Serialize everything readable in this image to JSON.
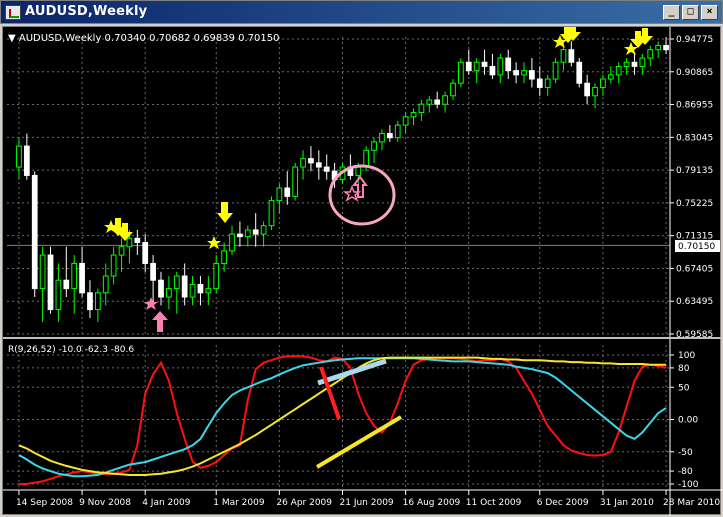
{
  "window": {
    "title": "AUDUSD,Weekly",
    "buttons": {
      "minimize": "_",
      "restore": "□",
      "close": "×"
    }
  },
  "colors": {
    "background": "#000000",
    "bull_candle": "#00ff00",
    "bear_candle": "#ffffff",
    "grid": "#6c6c6c",
    "wpr_line": "#ff1010",
    "signal_cyan": "#3ad7e8",
    "signal_yellow": "#f5e62a",
    "arrow_yellow": "#ffff00",
    "arrow_pink": "#ff7fb4",
    "circle_pink": "#f7a7c1"
  },
  "main": {
    "header": "▼ AUDUSD,Weekly  0.70340 0.70682 0.69839 0.70150",
    "current_price": "0.70150",
    "price_ticks": [
      "0.94775",
      "0.90865",
      "0.86955",
      "0.83045",
      "0.79135",
      "0.75225",
      "0.71315",
      "0.67405",
      "0.63495",
      "0.59585"
    ]
  },
  "indicator": {
    "header": "R(9,26,52) -10.0 -62.3 -80.6",
    "ticks": [
      "100",
      "80",
      "50",
      "0.00",
      "-50",
      "-80",
      "-100"
    ]
  },
  "time_axis": {
    "labels": [
      "14 Sep 2008",
      "9 Nov 2008",
      "4 Jan 2009",
      "1 Mar 2009",
      "26 Apr 2009",
      "21 Jun 2009",
      "16 Aug 2009",
      "11 Oct 2009",
      "6 Dec 2009",
      "31 Jan 2010",
      "28 Mar 2010"
    ]
  },
  "chart_data": {
    "type": "candlestick",
    "symbol": "AUDUSD",
    "timeframe": "Weekly",
    "price_range": [
      0.59585,
      0.94775
    ],
    "indicator_range": [
      -100,
      100
    ],
    "candles": [
      {
        "o": 0.795,
        "h": 0.83,
        "l": 0.78,
        "c": 0.82
      },
      {
        "o": 0.82,
        "h": 0.835,
        "l": 0.78,
        "c": 0.785
      },
      {
        "o": 0.785,
        "h": 0.79,
        "l": 0.64,
        "c": 0.65
      },
      {
        "o": 0.65,
        "h": 0.7,
        "l": 0.61,
        "c": 0.69
      },
      {
        "o": 0.69,
        "h": 0.7,
        "l": 0.62,
        "c": 0.625
      },
      {
        "o": 0.625,
        "h": 0.68,
        "l": 0.61,
        "c": 0.66
      },
      {
        "o": 0.66,
        "h": 0.7,
        "l": 0.64,
        "c": 0.65
      },
      {
        "o": 0.65,
        "h": 0.69,
        "l": 0.62,
        "c": 0.68
      },
      {
        "o": 0.68,
        "h": 0.7,
        "l": 0.64,
        "c": 0.645
      },
      {
        "o": 0.645,
        "h": 0.66,
        "l": 0.615,
        "c": 0.625
      },
      {
        "o": 0.625,
        "h": 0.65,
        "l": 0.61,
        "c": 0.645
      },
      {
        "o": 0.645,
        "h": 0.68,
        "l": 0.63,
        "c": 0.665
      },
      {
        "o": 0.665,
        "h": 0.7,
        "l": 0.655,
        "c": 0.69
      },
      {
        "o": 0.69,
        "h": 0.71,
        "l": 0.67,
        "c": 0.7
      },
      {
        "o": 0.7,
        "h": 0.72,
        "l": 0.68,
        "c": 0.71
      },
      {
        "o": 0.71,
        "h": 0.72,
        "l": 0.69,
        "c": 0.705
      },
      {
        "o": 0.705,
        "h": 0.715,
        "l": 0.67,
        "c": 0.68
      },
      {
        "o": 0.68,
        "h": 0.69,
        "l": 0.63,
        "c": 0.66
      },
      {
        "o": 0.66,
        "h": 0.67,
        "l": 0.63,
        "c": 0.64
      },
      {
        "o": 0.64,
        "h": 0.665,
        "l": 0.625,
        "c": 0.65
      },
      {
        "o": 0.65,
        "h": 0.67,
        "l": 0.62,
        "c": 0.665
      },
      {
        "o": 0.665,
        "h": 0.68,
        "l": 0.63,
        "c": 0.64
      },
      {
        "o": 0.64,
        "h": 0.665,
        "l": 0.63,
        "c": 0.655
      },
      {
        "o": 0.655,
        "h": 0.665,
        "l": 0.63,
        "c": 0.645
      },
      {
        "o": 0.645,
        "h": 0.665,
        "l": 0.63,
        "c": 0.65
      },
      {
        "o": 0.65,
        "h": 0.69,
        "l": 0.645,
        "c": 0.68
      },
      {
        "o": 0.68,
        "h": 0.705,
        "l": 0.67,
        "c": 0.695
      },
      {
        "o": 0.695,
        "h": 0.725,
        "l": 0.69,
        "c": 0.715
      },
      {
        "o": 0.715,
        "h": 0.73,
        "l": 0.7,
        "c": 0.712
      },
      {
        "o": 0.712,
        "h": 0.725,
        "l": 0.7,
        "c": 0.72
      },
      {
        "o": 0.72,
        "h": 0.74,
        "l": 0.7,
        "c": 0.715
      },
      {
        "o": 0.715,
        "h": 0.73,
        "l": 0.7,
        "c": 0.725
      },
      {
        "o": 0.725,
        "h": 0.76,
        "l": 0.72,
        "c": 0.755
      },
      {
        "o": 0.755,
        "h": 0.775,
        "l": 0.74,
        "c": 0.77
      },
      {
        "o": 0.77,
        "h": 0.79,
        "l": 0.75,
        "c": 0.76
      },
      {
        "o": 0.76,
        "h": 0.8,
        "l": 0.755,
        "c": 0.795
      },
      {
        "o": 0.795,
        "h": 0.815,
        "l": 0.78,
        "c": 0.805
      },
      {
        "o": 0.805,
        "h": 0.82,
        "l": 0.79,
        "c": 0.8
      },
      {
        "o": 0.8,
        "h": 0.815,
        "l": 0.78,
        "c": 0.795
      },
      {
        "o": 0.795,
        "h": 0.81,
        "l": 0.78,
        "c": 0.79
      },
      {
        "o": 0.79,
        "h": 0.8,
        "l": 0.77,
        "c": 0.78
      },
      {
        "o": 0.78,
        "h": 0.8,
        "l": 0.775,
        "c": 0.795
      },
      {
        "o": 0.795,
        "h": 0.81,
        "l": 0.78,
        "c": 0.785
      },
      {
        "o": 0.785,
        "h": 0.8,
        "l": 0.77,
        "c": 0.795
      },
      {
        "o": 0.795,
        "h": 0.82,
        "l": 0.79,
        "c": 0.815
      },
      {
        "o": 0.815,
        "h": 0.83,
        "l": 0.8,
        "c": 0.825
      },
      {
        "o": 0.825,
        "h": 0.84,
        "l": 0.815,
        "c": 0.835
      },
      {
        "o": 0.835,
        "h": 0.845,
        "l": 0.825,
        "c": 0.83
      },
      {
        "o": 0.83,
        "h": 0.85,
        "l": 0.825,
        "c": 0.845
      },
      {
        "o": 0.845,
        "h": 0.86,
        "l": 0.835,
        "c": 0.855
      },
      {
        "o": 0.855,
        "h": 0.865,
        "l": 0.845,
        "c": 0.86
      },
      {
        "o": 0.86,
        "h": 0.875,
        "l": 0.85,
        "c": 0.87
      },
      {
        "o": 0.87,
        "h": 0.88,
        "l": 0.86,
        "c": 0.875
      },
      {
        "o": 0.875,
        "h": 0.885,
        "l": 0.865,
        "c": 0.87
      },
      {
        "o": 0.87,
        "h": 0.885,
        "l": 0.86,
        "c": 0.88
      },
      {
        "o": 0.88,
        "h": 0.9,
        "l": 0.875,
        "c": 0.895
      },
      {
        "o": 0.895,
        "h": 0.925,
        "l": 0.89,
        "c": 0.92
      },
      {
        "o": 0.92,
        "h": 0.935,
        "l": 0.905,
        "c": 0.91
      },
      {
        "o": 0.91,
        "h": 0.925,
        "l": 0.895,
        "c": 0.92
      },
      {
        "o": 0.92,
        "h": 0.935,
        "l": 0.905,
        "c": 0.915
      },
      {
        "o": 0.915,
        "h": 0.93,
        "l": 0.9,
        "c": 0.905
      },
      {
        "o": 0.905,
        "h": 0.93,
        "l": 0.895,
        "c": 0.925
      },
      {
        "o": 0.925,
        "h": 0.935,
        "l": 0.9,
        "c": 0.91
      },
      {
        "o": 0.91,
        "h": 0.92,
        "l": 0.895,
        "c": 0.905
      },
      {
        "o": 0.905,
        "h": 0.92,
        "l": 0.895,
        "c": 0.91
      },
      {
        "o": 0.91,
        "h": 0.925,
        "l": 0.89,
        "c": 0.9
      },
      {
        "o": 0.9,
        "h": 0.915,
        "l": 0.88,
        "c": 0.89
      },
      {
        "o": 0.89,
        "h": 0.905,
        "l": 0.88,
        "c": 0.9
      },
      {
        "o": 0.9,
        "h": 0.925,
        "l": 0.895,
        "c": 0.92
      },
      {
        "o": 0.92,
        "h": 0.945,
        "l": 0.91,
        "c": 0.935
      },
      {
        "o": 0.935,
        "h": 0.945,
        "l": 0.915,
        "c": 0.92
      },
      {
        "o": 0.92,
        "h": 0.925,
        "l": 0.89,
        "c": 0.895
      },
      {
        "o": 0.895,
        "h": 0.905,
        "l": 0.87,
        "c": 0.88
      },
      {
        "o": 0.88,
        "h": 0.895,
        "l": 0.865,
        "c": 0.89
      },
      {
        "o": 0.89,
        "h": 0.905,
        "l": 0.88,
        "c": 0.9
      },
      {
        "o": 0.9,
        "h": 0.915,
        "l": 0.895,
        "c": 0.905
      },
      {
        "o": 0.905,
        "h": 0.92,
        "l": 0.895,
        "c": 0.915
      },
      {
        "o": 0.915,
        "h": 0.925,
        "l": 0.905,
        "c": 0.92
      },
      {
        "o": 0.92,
        "h": 0.93,
        "l": 0.905,
        "c": 0.915
      },
      {
        "o": 0.915,
        "h": 0.93,
        "l": 0.905,
        "c": 0.925
      },
      {
        "o": 0.925,
        "h": 0.94,
        "l": 0.915,
        "c": 0.935
      },
      {
        "o": 0.935,
        "h": 0.945,
        "l": 0.925,
        "c": 0.94
      },
      {
        "o": 0.94,
        "h": 0.95,
        "l": 0.93,
        "c": 0.935
      }
    ],
    "series": [
      {
        "values": [
          -100,
          -100,
          -98,
          -96,
          -92,
          -88,
          -85,
          -82,
          -80,
          -82,
          -84,
          -85,
          -84,
          -82,
          -78,
          -40,
          40,
          70,
          88,
          60,
          10,
          -30,
          -65,
          -75,
          -72,
          -66,
          -55,
          -45,
          -40,
          30,
          78,
          88,
          92,
          96,
          98,
          98,
          98,
          96,
          92,
          90,
          96,
          94,
          80,
          40,
          10,
          -10,
          -20,
          -5,
          25,
          60,
          85,
          92,
          94,
          95,
          95,
          95,
          94,
          92,
          90,
          92,
          92,
          94,
          90,
          80,
          60,
          40,
          15,
          -10,
          -25,
          -40,
          -48,
          -52,
          -55,
          -56,
          -55,
          -50,
          -20,
          20,
          60,
          82,
          85,
          83,
          80
        ]
      },
      {
        "values": [
          -55,
          -62,
          -70,
          -76,
          -80,
          -84,
          -86,
          -88,
          -88,
          -87,
          -86,
          -82,
          -78,
          -74,
          -70,
          -68,
          -66,
          -62,
          -58,
          -54,
          -50,
          -46,
          -40,
          -30,
          -10,
          10,
          25,
          38,
          45,
          50,
          55,
          60,
          64,
          70,
          75,
          80,
          84,
          86,
          88,
          90,
          92,
          93,
          94,
          95,
          95,
          95,
          95,
          95,
          95,
          95,
          95,
          94,
          93,
          92,
          91,
          90,
          90,
          90,
          89,
          88,
          87,
          86,
          85,
          82,
          80,
          78,
          75,
          72,
          65,
          55,
          45,
          35,
          25,
          15,
          5,
          -5,
          -15,
          -25,
          -30,
          -20,
          -5,
          10,
          18
        ]
      },
      {
        "values": [
          -40,
          -45,
          -52,
          -58,
          -64,
          -68,
          -72,
          -75,
          -78,
          -80,
          -82,
          -83,
          -84,
          -85,
          -86,
          -86,
          -86,
          -85,
          -84,
          -82,
          -80,
          -77,
          -73,
          -68,
          -62,
          -56,
          -50,
          -44,
          -38,
          -31,
          -24,
          -16,
          -8,
          0,
          8,
          16,
          24,
          32,
          40,
          48,
          56,
          64,
          72,
          80,
          87,
          92,
          95,
          96,
          96,
          96,
          96,
          96,
          96,
          96,
          96,
          96,
          96,
          96,
          96,
          95,
          94,
          94,
          93,
          93,
          92,
          92,
          92,
          91,
          90,
          90,
          89,
          89,
          88,
          88,
          87,
          87,
          86,
          86,
          86,
          86,
          85,
          85,
          85
        ]
      }
    ]
  }
}
